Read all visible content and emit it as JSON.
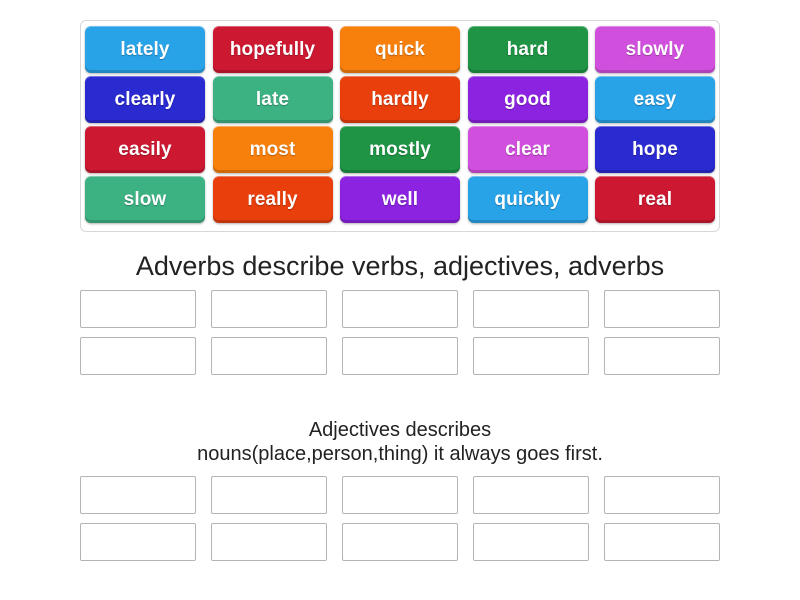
{
  "activity": {
    "type": "group-sort",
    "tile_rows": 4,
    "tiles_per_row": 5,
    "slots_per_row": 5
  },
  "word_bank": {
    "name": "word-bank",
    "tiles": [
      [
        {
          "label": "lately",
          "color": "#29a3e8"
        },
        {
          "label": "hopefully",
          "color": "#cc1931"
        },
        {
          "label": "quick",
          "color": "#f77f0c"
        },
        {
          "label": "hard",
          "color": "#1e9444"
        },
        {
          "label": "slowly",
          "color": "#d14fdd"
        }
      ],
      [
        {
          "label": "clearly",
          "color": "#2a2ad1"
        },
        {
          "label": "late",
          "color": "#3cb283"
        },
        {
          "label": "hardly",
          "color": "#e83f0c"
        },
        {
          "label": "good",
          "color": "#8b23e0"
        },
        {
          "label": "easy",
          "color": "#29a3e8"
        }
      ],
      [
        {
          "label": "easily",
          "color": "#cc1931"
        },
        {
          "label": "most",
          "color": "#f77f0c"
        },
        {
          "label": "mostly",
          "color": "#1e9444"
        },
        {
          "label": "clear",
          "color": "#d14fdd"
        },
        {
          "label": "hope",
          "color": "#2a2ad1"
        }
      ],
      [
        {
          "label": "slow",
          "color": "#3cb283"
        },
        {
          "label": "really",
          "color": "#e83f0c"
        },
        {
          "label": "well",
          "color": "#8b23e0"
        },
        {
          "label": "quickly",
          "color": "#29a3e8"
        },
        {
          "label": "real",
          "color": "#cc1931"
        }
      ]
    ]
  },
  "groups": [
    {
      "title": "Adverbs describe verbs, adjectives, adverbs",
      "title_size": "large",
      "rows": [
        [
          "",
          "",
          "",
          "",
          ""
        ],
        [
          "",
          "",
          "",
          "",
          ""
        ]
      ]
    },
    {
      "title": "Adjectives describes\nnouns(place,person,thing) it always goes first.",
      "title_size": "small",
      "rows": [
        [
          "",
          "",
          "",
          "",
          ""
        ],
        [
          "",
          "",
          "",
          "",
          ""
        ]
      ]
    }
  ],
  "colors": {
    "page_background": "#ffffff",
    "bank_border": "#d8d8d8",
    "slot_border": "#b4b4b4",
    "slot_fill": "#ffffff",
    "title_text": "#222222",
    "tile_text": "#ffffff"
  }
}
